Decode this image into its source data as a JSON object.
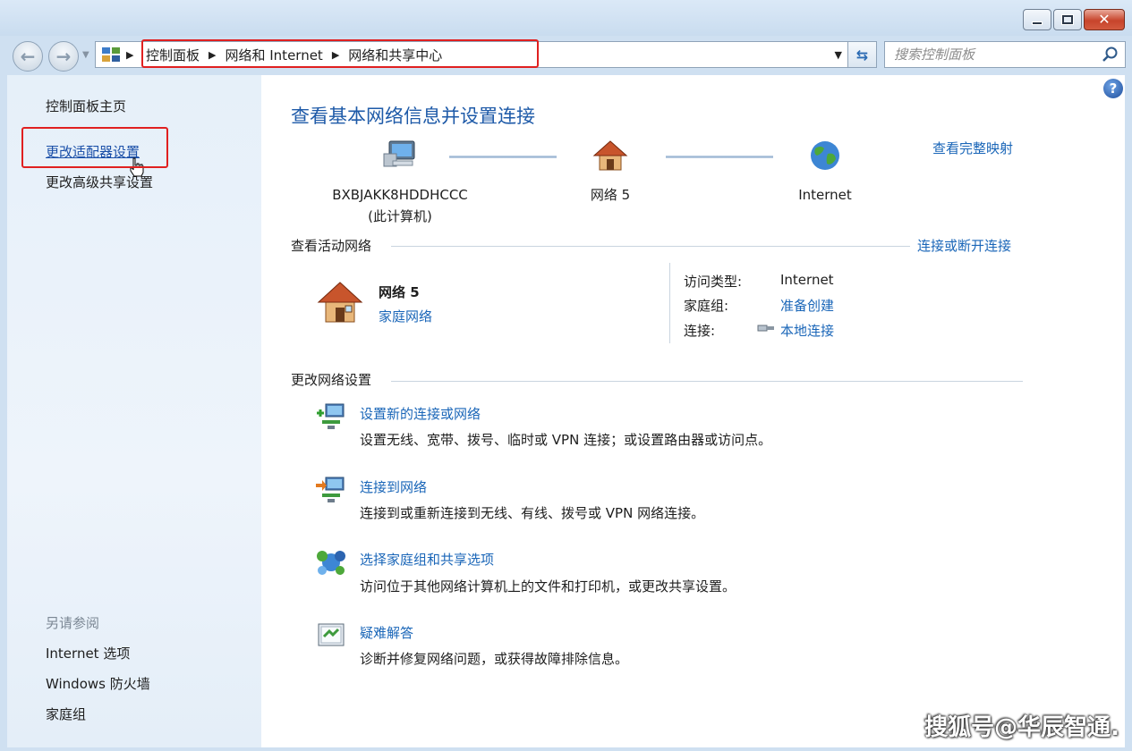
{
  "window": {
    "minimize_icon": "minimize-icon",
    "maximize_icon": "maximize-icon",
    "close_icon": "close-icon",
    "close_glyph": "✕"
  },
  "address_bar": {
    "breadcrumbs": [
      "控制面板",
      "网络和 Internet",
      "网络和共享中心"
    ],
    "search_placeholder": "搜索控制面板"
  },
  "left_pane": {
    "links": [
      "控制面板主页",
      "更改适配器设置",
      "更改高级共享设置"
    ],
    "see_also_heading": "另请参阅",
    "see_also": [
      "Internet 选项",
      "Windows 防火墙",
      "家庭组"
    ]
  },
  "main": {
    "title": "查看基本网络信息并设置连接",
    "full_map_link": "查看完整映射",
    "network_map": {
      "computer_name": "BXBJAKK8HDDHCCC",
      "computer_sub": "(此计算机)",
      "network": "网络  5",
      "internet": "Internet"
    },
    "active_networks": {
      "heading": "查看活动网络",
      "connect_link": "连接或断开连接",
      "name": "网络  5",
      "type": "家庭网络",
      "access_type_label": "访问类型:",
      "access_type_value": "Internet",
      "homegroup_label": "家庭组:",
      "homegroup_value": "准备创建",
      "connection_label": "连接:",
      "connection_value": "本地连接"
    },
    "change_settings": {
      "heading": "更改网络设置",
      "tasks": [
        {
          "title": "设置新的连接或网络",
          "desc": "设置无线、宽带、拨号、临时或 VPN 连接；或设置路由器或访问点。"
        },
        {
          "title": "连接到网络",
          "desc": "连接到或重新连接到无线、有线、拨号或 VPN 网络连接。"
        },
        {
          "title": "选择家庭组和共享选项",
          "desc": "访问位于其他网络计算机上的文件和打印机，或更改共享设置。"
        },
        {
          "title": "疑难解答",
          "desc": "诊断并修复网络问题，或获得故障排除信息。"
        }
      ]
    }
  },
  "watermark": "搜狐号@华辰智通."
}
